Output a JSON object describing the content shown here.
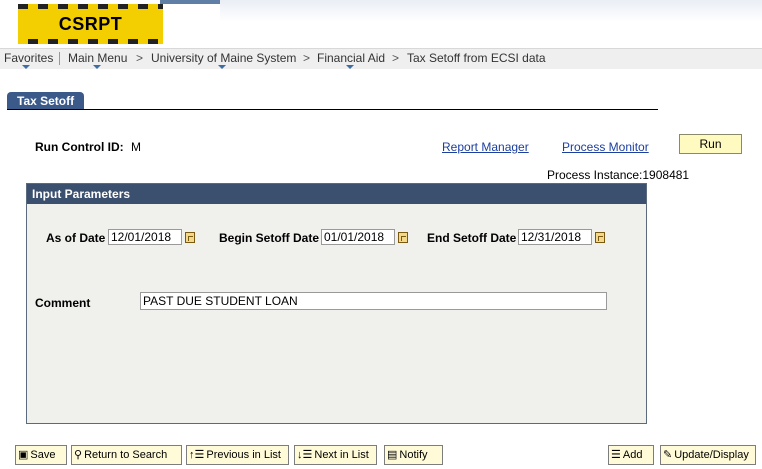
{
  "header": {
    "logo_text": "CSRPT"
  },
  "nav": {
    "favorites": "Favorites",
    "main_menu": "Main Menu",
    "crumb1": "University of Maine System",
    "crumb2": "Financial Aid",
    "crumb3": "Tax Setoff from ECSI data",
    "separator": ">"
  },
  "tab": {
    "label": "Tax Setoff"
  },
  "run_control": {
    "label": "Run Control ID:",
    "value": "M"
  },
  "links": {
    "report_manager": "Report Manager",
    "process_monitor": "Process Monitor"
  },
  "run_button": "Run",
  "process_instance": "Process Instance:1908481",
  "input_params": {
    "title": "Input Parameters",
    "as_of_label": "As of Date",
    "as_of_value": "12/01/2018",
    "begin_label": "Begin Setoff Date",
    "begin_value": "01/01/2018",
    "end_label": "End Setoff Date",
    "end_value": "12/31/2018",
    "comment_label": "Comment",
    "comment_value": "PAST DUE STUDENT LOAN"
  },
  "toolbar": {
    "save": "Save",
    "return_to_search": "Return to Search",
    "previous_in_list": "Previous in List",
    "next_in_list": "Next in List",
    "notify": "Notify",
    "add": "Add",
    "update_display": "Update/Display"
  },
  "icons": {
    "calendar": "calendar-icon",
    "save": "save-icon",
    "search": "search-icon",
    "previous": "previous-list-icon",
    "next": "next-list-icon",
    "notify": "notify-icon",
    "add": "add-icon",
    "update": "update-display-icon"
  },
  "colors": {
    "logo_bg": "#f3ce00",
    "tab_bg": "#3b5a8a",
    "group_header": "#3b4f6f",
    "link": "#1c3fa0",
    "button_bg": "#fffbd8"
  }
}
